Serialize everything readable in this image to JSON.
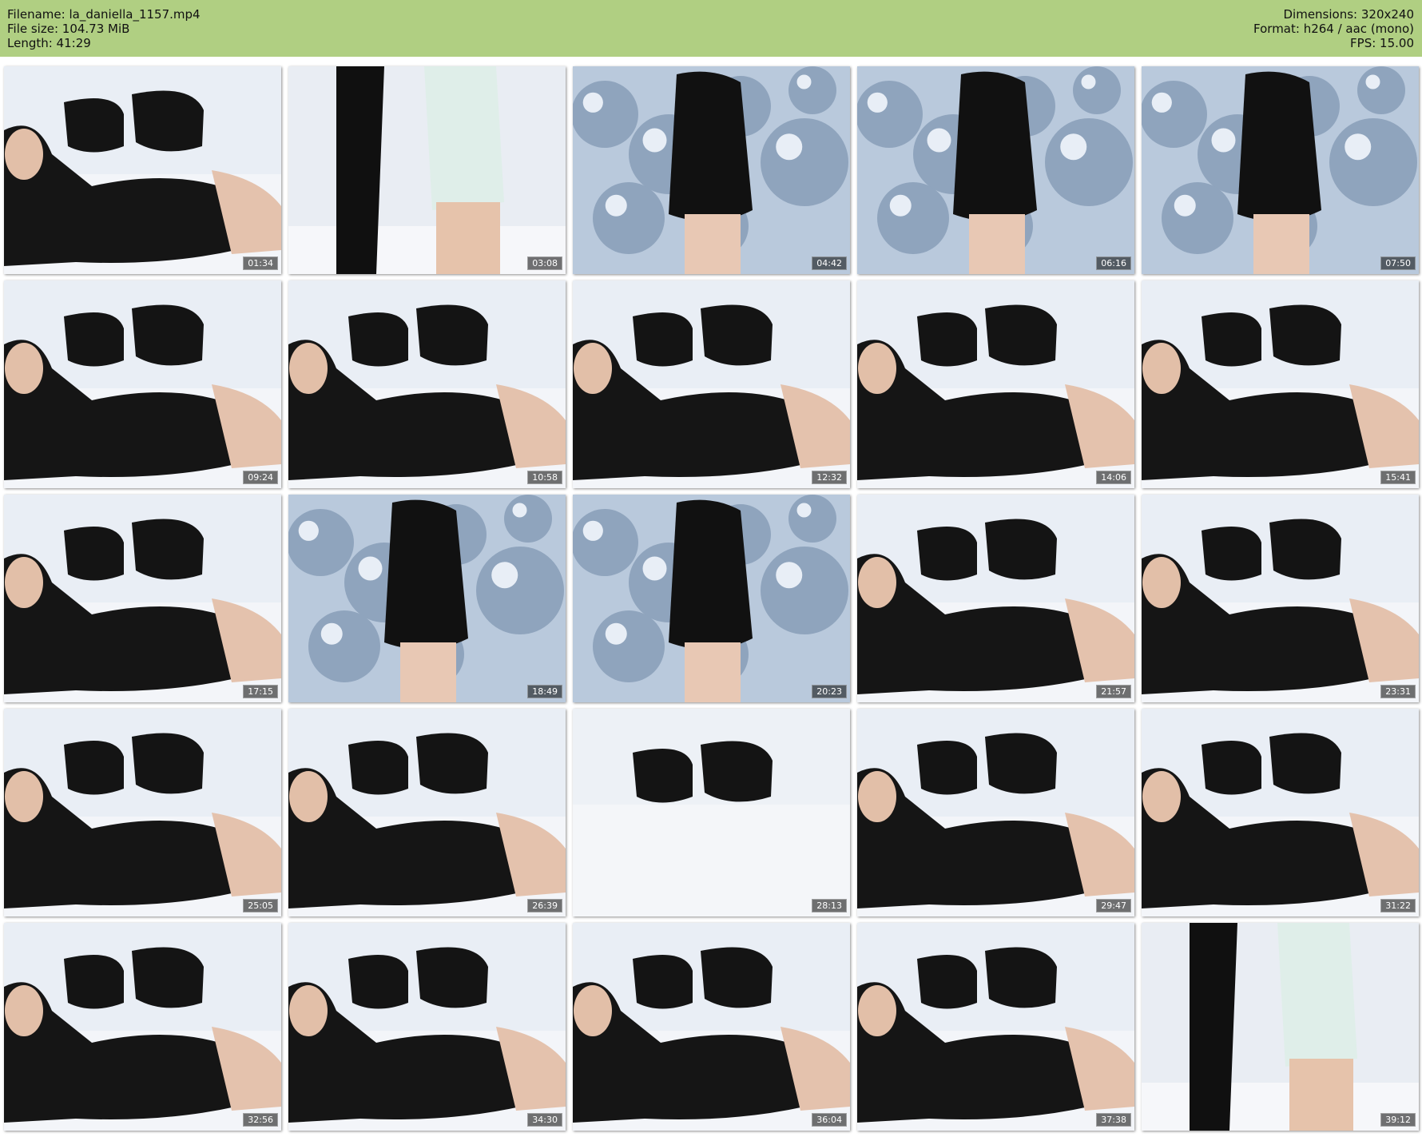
{
  "header": {
    "filename": "Filename: la_daniella_1157.mp4",
    "filesize": "File size: 104.73 MiB",
    "length": "Length: 41:29",
    "dimensions": "Dimensions: 320x240",
    "format": "Format: h264 / aac (mono)",
    "fps": "FPS: 15.00"
  },
  "thumbnails": [
    {
      "time": "01:34",
      "scene": "bed"
    },
    {
      "time": "03:08",
      "scene": "standing"
    },
    {
      "time": "04:42",
      "scene": "spheres"
    },
    {
      "time": "06:16",
      "scene": "spheres"
    },
    {
      "time": "07:50",
      "scene": "spheres"
    },
    {
      "time": "09:24",
      "scene": "bed"
    },
    {
      "time": "10:58",
      "scene": "bed"
    },
    {
      "time": "12:32",
      "scene": "bed"
    },
    {
      "time": "14:06",
      "scene": "bed"
    },
    {
      "time": "15:41",
      "scene": "bed"
    },
    {
      "time": "17:15",
      "scene": "bed"
    },
    {
      "time": "18:49",
      "scene": "spheres"
    },
    {
      "time": "20:23",
      "scene": "spheres"
    },
    {
      "time": "21:57",
      "scene": "bed"
    },
    {
      "time": "23:31",
      "scene": "bed"
    },
    {
      "time": "25:05",
      "scene": "bed"
    },
    {
      "time": "26:39",
      "scene": "bed"
    },
    {
      "time": "28:13",
      "scene": "empty"
    },
    {
      "time": "29:47",
      "scene": "bed"
    },
    {
      "time": "31:22",
      "scene": "bed"
    },
    {
      "time": "32:56",
      "scene": "bed"
    },
    {
      "time": "34:30",
      "scene": "bed"
    },
    {
      "time": "36:04",
      "scene": "bed"
    },
    {
      "time": "37:38",
      "scene": "bed"
    },
    {
      "time": "39:12",
      "scene": "standing"
    }
  ],
  "colors": {
    "header_bg": "#b0cf82",
    "page_bg": "#ffffff"
  }
}
